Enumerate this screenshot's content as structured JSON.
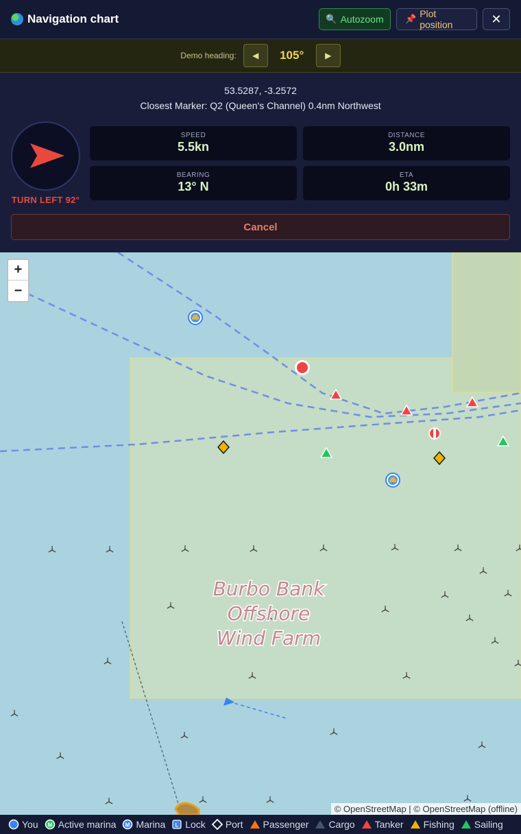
{
  "header": {
    "title": "Navigation chart",
    "autozoom_label": "Autozoom",
    "plot_label": "Plot position",
    "close_label": "✕"
  },
  "demo": {
    "label": "Demo heading:",
    "prev": "◀",
    "value": "105°",
    "next": "▶"
  },
  "nav": {
    "coords": "53.5287, -3.2572",
    "closest": "Closest Marker: Q2 (Queen's Channel) 0.4nm Northwest",
    "turn": "TURN LEFT 92°",
    "stats": [
      {
        "key": "SPEED",
        "value": "5.5kn"
      },
      {
        "key": "DISTANCE",
        "value": "3.0nm"
      },
      {
        "key": "BEARING",
        "value": "13° N"
      },
      {
        "key": "ETA",
        "value": "0h 33m"
      }
    ],
    "cancel": "Cancel"
  },
  "map": {
    "zoom_in": "+",
    "zoom_out": "−",
    "area_label": [
      "Burbo Bank",
      "Offshore",
      "Wind Farm"
    ],
    "attribution": "© OpenStreetMap | © OpenStreetMap (offline)"
  },
  "legend": [
    {
      "label": "You",
      "symbol": "circle",
      "letter": "",
      "color": "#3b82f6"
    },
    {
      "label": "Active marina",
      "symbol": "circle",
      "letter": "M",
      "color": "#22c55e"
    },
    {
      "label": "Marina",
      "symbol": "circle",
      "letter": "M",
      "color": "#3b82f6"
    },
    {
      "label": "Lock",
      "symbol": "square",
      "letter": "L",
      "color": "#3b82f6"
    },
    {
      "label": "Port",
      "symbol": "diamond",
      "letter": "",
      "color": "#ffffff"
    },
    {
      "label": "Passenger",
      "symbol": "triangle",
      "letter": "",
      "color": "#f97316"
    },
    {
      "label": "Cargo",
      "symbol": "triangle",
      "letter": "",
      "color": "#475569"
    },
    {
      "label": "Tanker",
      "symbol": "triangle",
      "letter": "",
      "color": "#ef4444"
    },
    {
      "label": "Fishing",
      "symbol": "triangle",
      "letter": "",
      "color": "#eab308"
    },
    {
      "label": "Sailing",
      "symbol": "triangle",
      "letter": "",
      "color": "#22c55e"
    }
  ],
  "colors": {
    "sea": "#aad3df",
    "windfarm_area": "#c5dcc6",
    "accent_green": "#6fe08a",
    "heading_yellow": "#f0d456",
    "turn_red": "#e8493c"
  }
}
